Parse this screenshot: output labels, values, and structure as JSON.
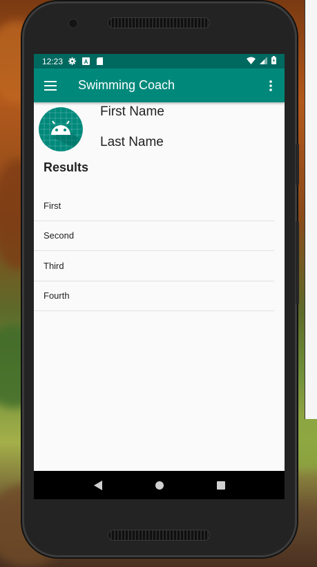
{
  "statusbar": {
    "time": "12:23",
    "icons": [
      "gear-icon",
      "a-icon",
      "sd-card-icon"
    ],
    "right_icons": [
      "wifi-icon",
      "signal-icon",
      "battery-icon"
    ]
  },
  "appbar": {
    "title": "Swimming Coach",
    "menu_icon": "hamburger-menu-icon",
    "overflow_icon": "more-vert-icon",
    "color": "#00897b",
    "status_color": "#00695f"
  },
  "profile": {
    "first_name": "First Name",
    "last_name": "Last Name",
    "avatar_icon": "android-icon"
  },
  "results": {
    "heading": "Results",
    "items": [
      "First",
      "Second",
      "Third",
      "Fourth"
    ]
  },
  "navbar": {
    "buttons": [
      "back-icon",
      "home-icon",
      "recents-icon"
    ]
  }
}
